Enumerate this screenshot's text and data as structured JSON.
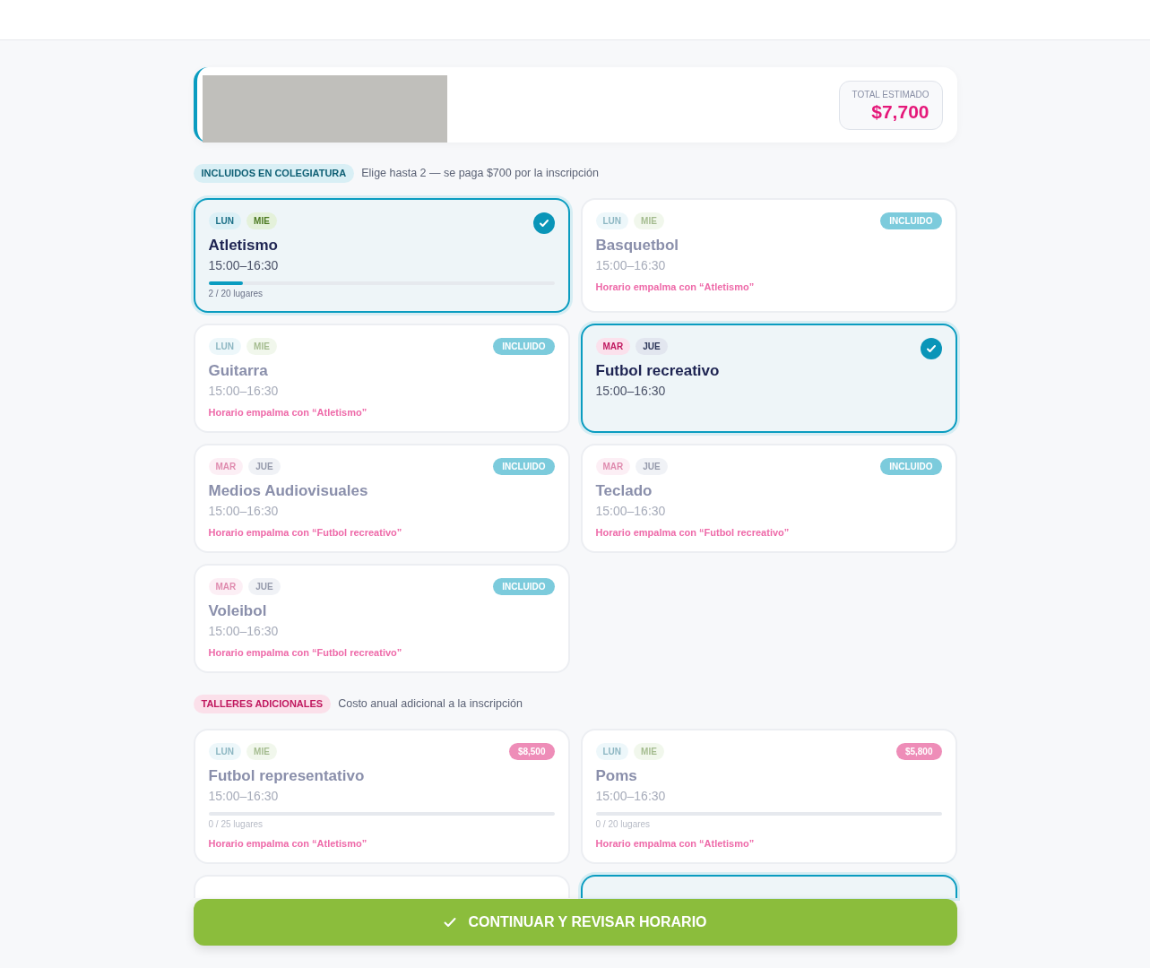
{
  "summary": {
    "total_label": "TOTAL ESTIMADO",
    "total": "$7,700"
  },
  "sections": [
    {
      "kind": "included",
      "label": "INCLUIDOS EN COLEGIATURA",
      "note": "Elige hasta 2 — se paga $700 por la inscripción",
      "cards": [
        {
          "days": [
            {
              "label": "LUN",
              "kind": "lun"
            },
            {
              "label": "MIE",
              "kind": "mie"
            }
          ],
          "name": "Atletismo",
          "time": "15:00–16:30",
          "selected": true,
          "disabled": false,
          "progress": {
            "level": 0.1,
            "text": "2 / 20 lugares"
          }
        },
        {
          "days": [
            {
              "label": "LUN",
              "kind": "lun"
            },
            {
              "label": "MIE",
              "kind": "mie"
            }
          ],
          "name": "Basquetbol",
          "time": "15:00–16:30",
          "selected": false,
          "disabled": true,
          "badge": "INCLUIDO",
          "conflict": "Horario empalma con “Atletismo”"
        },
        {
          "days": [
            {
              "label": "LUN",
              "kind": "lun"
            },
            {
              "label": "MIE",
              "kind": "mie"
            }
          ],
          "name": "Guitarra",
          "time": "15:00–16:30",
          "selected": false,
          "disabled": true,
          "badge": "INCLUIDO",
          "conflict": "Horario empalma con “Atletismo”"
        },
        {
          "days": [
            {
              "label": "MAR",
              "kind": "mar"
            },
            {
              "label": "JUE",
              "kind": "jue"
            }
          ],
          "name": "Futbol recreativo",
          "time": "15:00–16:30",
          "selected": true,
          "disabled": false
        },
        {
          "days": [
            {
              "label": "MAR",
              "kind": "mar"
            },
            {
              "label": "JUE",
              "kind": "jue"
            }
          ],
          "name": "Medios Audiovisuales",
          "time": "15:00–16:30",
          "selected": false,
          "disabled": true,
          "badge": "INCLUIDO",
          "conflict": "Horario empalma con “Futbol recreativo”"
        },
        {
          "days": [
            {
              "label": "MAR",
              "kind": "mar"
            },
            {
              "label": "JUE",
              "kind": "jue"
            }
          ],
          "name": "Teclado",
          "time": "15:00–16:30",
          "selected": false,
          "disabled": true,
          "badge": "INCLUIDO",
          "conflict": "Horario empalma con “Futbol recreativo”"
        },
        {
          "days": [
            {
              "label": "MAR",
              "kind": "mar"
            },
            {
              "label": "JUE",
              "kind": "jue"
            }
          ],
          "name": "Voleibol",
          "time": "15:00–16:30",
          "selected": false,
          "disabled": true,
          "badge": "INCLUIDO",
          "conflict": "Horario empalma con “Futbol recreativo”"
        }
      ]
    },
    {
      "kind": "additional",
      "label": "TALLERES ADICIONALES",
      "note": "Costo anual adicional a la inscripción",
      "cards": [
        {
          "days": [
            {
              "label": "LUN",
              "kind": "lun"
            },
            {
              "label": "MIE",
              "kind": "mie"
            }
          ],
          "name": "Futbol representativo",
          "time": "15:00–16:30",
          "selected": false,
          "disabled": true,
          "badge": "$8,500",
          "progress": {
            "level": 0,
            "text": "0 / 25 lugares"
          },
          "conflict": "Horario empalma con “Atletismo”"
        },
        {
          "days": [
            {
              "label": "LUN",
              "kind": "lun"
            },
            {
              "label": "MIE",
              "kind": "mie"
            }
          ],
          "name": "Poms",
          "time": "15:00–16:30",
          "selected": false,
          "disabled": true,
          "badge": "$5,800",
          "progress": {
            "level": 0,
            "text": "0 / 20 lugares"
          },
          "conflict": "Horario empalma con “Atletismo”"
        },
        {
          "selected": false
        },
        {
          "selected": true
        }
      ]
    }
  ],
  "continue_button": {
    "label": "CONTINUAR Y REVISAR HORARIO"
  }
}
